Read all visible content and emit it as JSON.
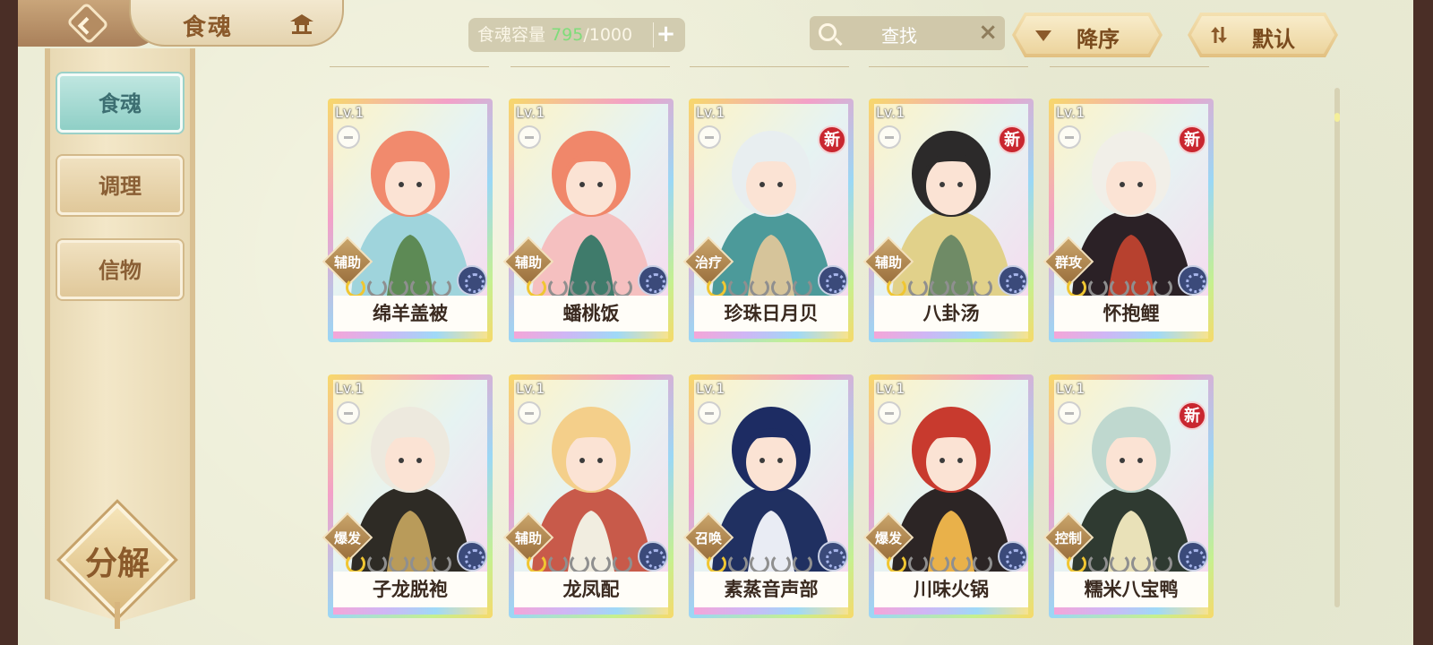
{
  "header": {
    "title": "食魂",
    "capacity": {
      "label": "食魂容量",
      "current": "795",
      "max": "/1000",
      "plus": "+"
    },
    "search": {
      "placeholder": "查找",
      "clear": "×"
    },
    "sort_order": "降序",
    "sort_mode": "默认"
  },
  "sidebar": {
    "items": [
      {
        "label": "食魂",
        "active": true
      },
      {
        "label": "调理",
        "active": false
      },
      {
        "label": "信物",
        "active": false
      }
    ],
    "decompose": "分解"
  },
  "colors": {
    "capacity_current": "#7fdc7a",
    "active_tab": "#8fcfc6",
    "new_badge": "#c9262f"
  },
  "cards": [
    {
      "name": "绵羊盖被",
      "level": "Lv.1",
      "role": "辅助",
      "new": false,
      "stars_lit": 1,
      "palette": [
        "#f18a6d",
        "#9fd4dc",
        "#5d8a55"
      ]
    },
    {
      "name": "蟠桃饭",
      "level": "Lv.1",
      "role": "辅助",
      "new": false,
      "stars_lit": 1,
      "palette": [
        "#f0876a",
        "#f5c0c0",
        "#3f7b6b"
      ]
    },
    {
      "name": "珍珠日月贝",
      "level": "Lv.1",
      "role": "治疗",
      "new": true,
      "badge": "新",
      "stars_lit": 1,
      "palette": [
        "#e8eef0",
        "#4c9a9a",
        "#d6c49a"
      ]
    },
    {
      "name": "八卦汤",
      "level": "Lv.1",
      "role": "辅助",
      "new": true,
      "badge": "新",
      "stars_lit": 1,
      "palette": [
        "#2c2a2a",
        "#e1d18a",
        "#6f8b66"
      ]
    },
    {
      "name": "怀抱鲤",
      "level": "Lv.1",
      "role": "群攻",
      "new": true,
      "badge": "新",
      "stars_lit": 1,
      "palette": [
        "#f1efe8",
        "#2b2126",
        "#b7412f"
      ]
    },
    {
      "name": "子龙脱袍",
      "level": "Lv.1",
      "role": "爆发",
      "new": false,
      "stars_lit": 1,
      "palette": [
        "#ede9de",
        "#2e2b25",
        "#b99b5a"
      ]
    },
    {
      "name": "龙凤配",
      "level": "Lv.1",
      "role": "辅助",
      "new": false,
      "stars_lit": 1,
      "palette": [
        "#f4cf8a",
        "#c85a4a",
        "#f1ede0"
      ]
    },
    {
      "name": "素蒸音声部",
      "level": "Lv.1",
      "role": "召唤",
      "new": false,
      "stars_lit": 1,
      "palette": [
        "#1d2c63",
        "#203061",
        "#e9ecf4"
      ]
    },
    {
      "name": "川味火锅",
      "level": "Lv.1",
      "role": "爆发",
      "new": false,
      "stars_lit": 1,
      "palette": [
        "#c83a2e",
        "#2c2525",
        "#e9b14a"
      ]
    },
    {
      "name": "糯米八宝鸭",
      "level": "Lv.1",
      "role": "控制",
      "new": true,
      "badge": "新",
      "stars_lit": 1,
      "palette": [
        "#bfd8cf",
        "#2f3a31",
        "#e9e1b8"
      ]
    }
  ]
}
